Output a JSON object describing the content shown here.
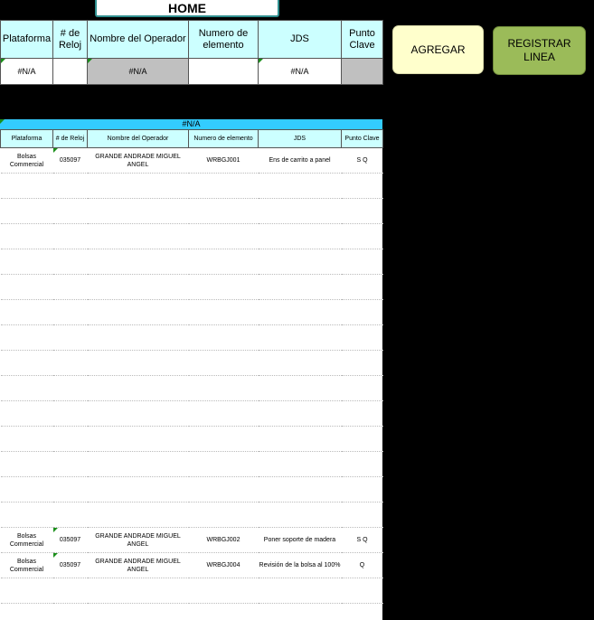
{
  "home_label": "HOME",
  "headers": [
    "Plataforma",
    "# de Reloj",
    "Nombre del Operador",
    "Numero de elemento",
    "JDS",
    "Punto Clave"
  ],
  "top_row": [
    "#N/A",
    "",
    "#N/A",
    "",
    "#N/A",
    ""
  ],
  "agregar_label": "AGREGAR",
  "registrar_label": "REGISTRAR LINEA",
  "list_title": "#N/A",
  "list_headers": [
    "Plataforma",
    "# de Reloj",
    "Nombre del Operador",
    "Numero de elemento",
    "JDS",
    "Punto Clave"
  ],
  "rows": [
    [
      "Bolsas Commercial",
      "035097",
      "GRANDE ANDRADE MIGUEL ANGEL",
      "WRBGJ001",
      "Ens de carrito a panel",
      "S Q"
    ],
    [
      "",
      "",
      "",
      "",
      "",
      ""
    ],
    [
      "",
      "",
      "",
      "",
      "",
      ""
    ],
    [
      "",
      "",
      "",
      "",
      "",
      ""
    ],
    [
      "",
      "",
      "",
      "",
      "",
      ""
    ],
    [
      "",
      "",
      "",
      "",
      "",
      ""
    ],
    [
      "",
      "",
      "",
      "",
      "",
      ""
    ],
    [
      "",
      "",
      "",
      "",
      "",
      ""
    ],
    [
      "",
      "",
      "",
      "",
      "",
      ""
    ],
    [
      "",
      "",
      "",
      "",
      "",
      ""
    ],
    [
      "",
      "",
      "",
      "",
      "",
      ""
    ],
    [
      "",
      "",
      "",
      "",
      "",
      ""
    ],
    [
      "",
      "",
      "",
      "",
      "",
      ""
    ],
    [
      "",
      "",
      "",
      "",
      "",
      ""
    ],
    [
      "",
      "",
      "",
      "",
      "",
      ""
    ],
    [
      "Bolsas Commercial",
      "035097",
      "GRANDE ANDRADE MIGUEL ANGEL",
      "WRBGJ002",
      "Poner soporte de madera",
      "S Q"
    ],
    [
      "Bolsas Commercial",
      "035097",
      "GRANDE ANDRADE MIGUEL ANGEL",
      "WRBGJ004",
      "Revisión de la bolsa al 100%",
      "Q"
    ],
    [
      "",
      "",
      "",
      "",
      "",
      ""
    ]
  ]
}
